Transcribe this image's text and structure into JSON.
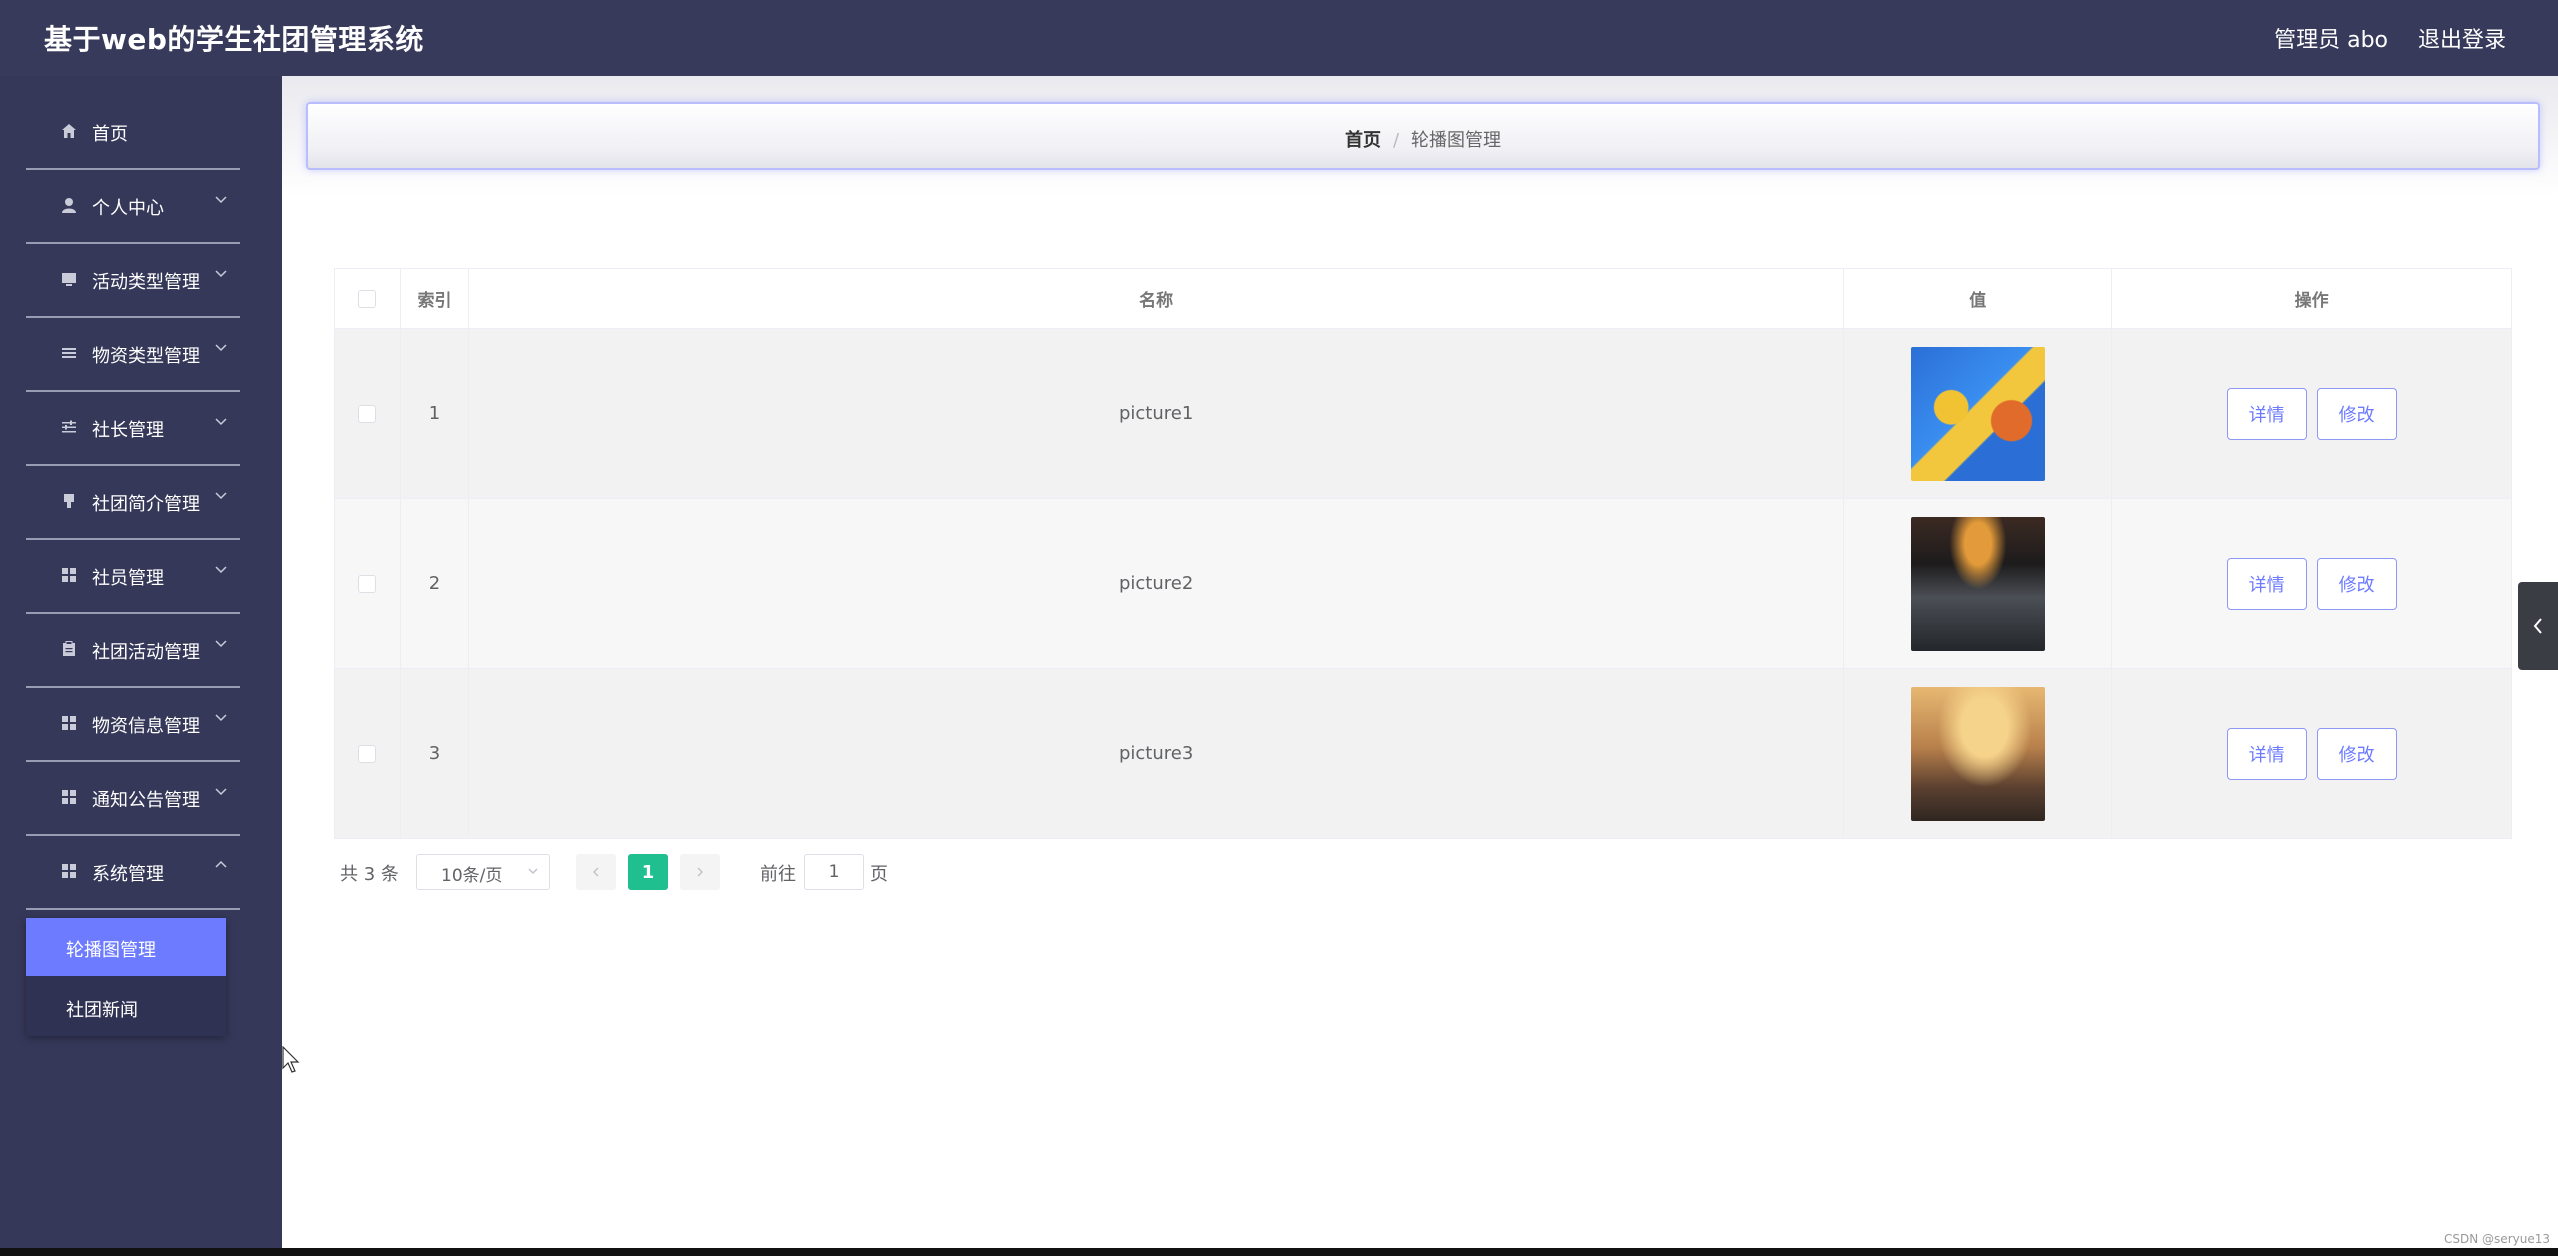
{
  "header": {
    "title": "基于web的学生社团管理系统",
    "admin": "管理员 abo",
    "logout": "退出登录"
  },
  "sidebar": {
    "items": [
      {
        "label": "首页",
        "icon": "home-icon"
      },
      {
        "label": "个人中心",
        "icon": "user-icon"
      },
      {
        "label": "活动类型管理",
        "icon": "monitor-icon"
      },
      {
        "label": "物资类型管理",
        "icon": "list-icon"
      },
      {
        "label": "社长管理",
        "icon": "sliders-icon"
      },
      {
        "label": "社团简介管理",
        "icon": "marker-icon"
      },
      {
        "label": "社员管理",
        "icon": "grid-icon"
      },
      {
        "label": "社团活动管理",
        "icon": "clipboard-icon"
      },
      {
        "label": "物资信息管理",
        "icon": "grid-icon"
      },
      {
        "label": "通知公告管理",
        "icon": "grid-icon"
      },
      {
        "label": "系统管理",
        "icon": "grid-icon"
      }
    ],
    "submenu": [
      {
        "label": "轮播图管理",
        "active": true
      },
      {
        "label": "社团新闻",
        "active": false
      }
    ]
  },
  "breadcrumb": {
    "home": "首页",
    "separator": "/",
    "current": "轮播图管理"
  },
  "table": {
    "headers": {
      "index": "索引",
      "name": "名称",
      "value": "值",
      "ops": "操作"
    },
    "rows": [
      {
        "index": "1",
        "name": "picture1",
        "detail": "详情",
        "edit": "修改"
      },
      {
        "index": "2",
        "name": "picture2",
        "detail": "详情",
        "edit": "修改"
      },
      {
        "index": "3",
        "name": "picture3",
        "detail": "详情",
        "edit": "修改"
      }
    ]
  },
  "pagination": {
    "total": "共 3 条",
    "page_size": "10条/页",
    "current_page": "1",
    "goto_label": "前往",
    "goto_value": "1",
    "page_unit": "页"
  },
  "watermark": "CSDN @seryue13",
  "colors": {
    "header_bg": "#373a5a",
    "sidebar_bg": "#353859",
    "accent": "#6c7bff",
    "page_active": "#1fbf8f"
  }
}
